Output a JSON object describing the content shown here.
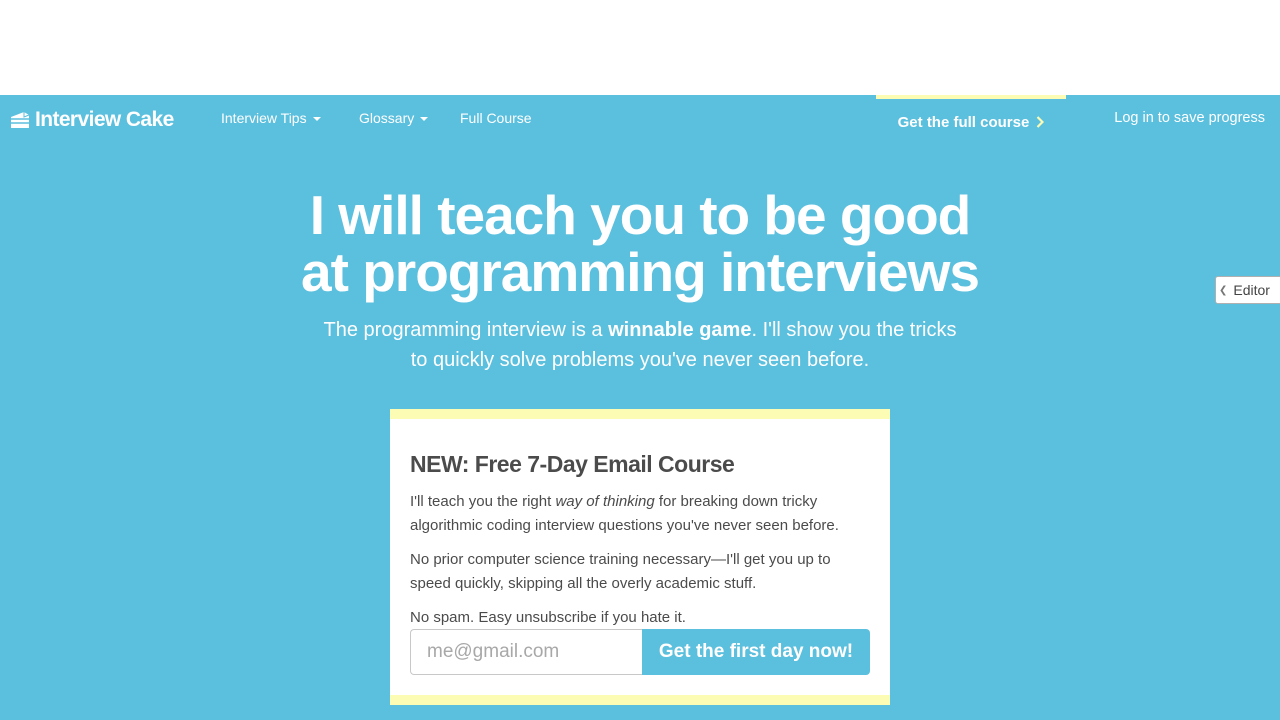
{
  "nav": {
    "logo_text": "Interview Cake",
    "items": [
      {
        "label": "Interview Tips",
        "dropdown": true
      },
      {
        "label": "Glossary",
        "dropdown": true
      },
      {
        "label": "Full Course",
        "dropdown": false
      }
    ],
    "cta_label": "Get the full course",
    "login_label": "Log in to save progress"
  },
  "hero": {
    "headline_line1": "I will teach you to be good",
    "headline_line2": "at programming interviews",
    "sub_before": "The programming interview is a ",
    "sub_bold": "winnable game",
    "sub_after": ". I'll show you the tricks",
    "sub_line2": "to quickly solve problems you've never seen before."
  },
  "card": {
    "title": "NEW: Free 7-Day Email Course",
    "p1_before": "I'll teach you the right ",
    "p1_italic": "way of thinking",
    "p1_after": " for breaking down tricky algorithmic coding interview questions you've never seen before.",
    "p2": "No prior computer science training necessary—I'll get you up to speed quickly, skipping all the overly academic stuff.",
    "p3": "No spam. Easy unsubscribe if you hate it.",
    "email_placeholder": "me@gmail.com",
    "submit_label": "Get the first day now!"
  },
  "editor_tab": {
    "label": "Editor"
  },
  "colors": {
    "brand_blue": "#5bbfde",
    "accent_yellow": "#fdfcb4",
    "text_dark": "#4b4b4b"
  }
}
